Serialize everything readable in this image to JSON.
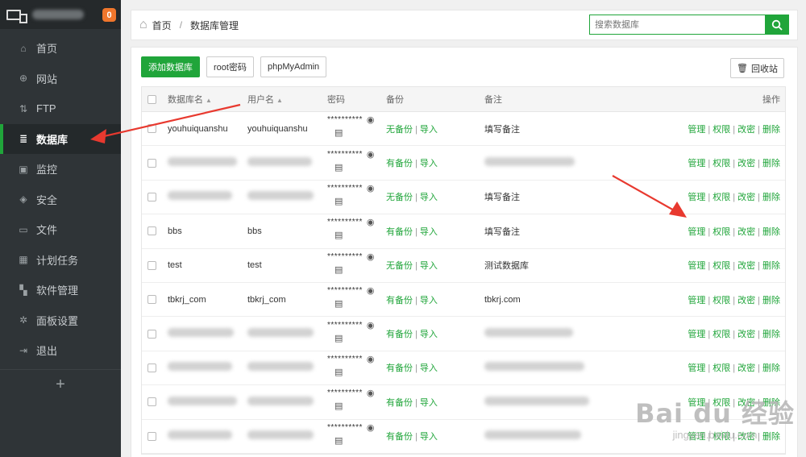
{
  "sidebar": {
    "badge": "0",
    "items": [
      {
        "label": "首页",
        "icon": "home-icon"
      },
      {
        "label": "网站",
        "icon": "globe-icon"
      },
      {
        "label": "FTP",
        "icon": "ftp-icon"
      },
      {
        "label": "数据库",
        "icon": "database-icon"
      },
      {
        "label": "监控",
        "icon": "monitor-icon"
      },
      {
        "label": "安全",
        "icon": "shield-icon"
      },
      {
        "label": "文件",
        "icon": "folder-icon"
      },
      {
        "label": "计划任务",
        "icon": "calendar-icon"
      },
      {
        "label": "软件管理",
        "icon": "apps-icon"
      },
      {
        "label": "面板设置",
        "icon": "gear-icon"
      },
      {
        "label": "退出",
        "icon": "logout-icon"
      }
    ],
    "active_index": 3,
    "add_label": "+"
  },
  "breadcrumb": {
    "home": "首页",
    "separator": "/",
    "current": "数据库管理"
  },
  "search": {
    "placeholder": "搜索数据库"
  },
  "toolbar": {
    "add_db": "添加数据库",
    "root_pwd": "root密码",
    "phpmyadmin": "phpMyAdmin",
    "recycle": "回收站"
  },
  "table": {
    "headers": {
      "name": "数据库名",
      "user": "用户名",
      "password": "密码",
      "backup": "备份",
      "note": "备注",
      "ops": "操作"
    },
    "password_mask": "**********",
    "backup_none": "无备份",
    "backup_has": "有备份",
    "import": "导入",
    "ops": [
      "管理",
      "权限",
      "改密",
      "删除"
    ],
    "rows": [
      {
        "name": "youhuiquanshu",
        "user": "youhuiquanshu",
        "backup": "无备份",
        "note": "填写备注"
      },
      {
        "name": "",
        "user": "",
        "backup": "有备份",
        "note": ""
      },
      {
        "name": "",
        "user": "",
        "backup": "无备份",
        "note": "填写备注"
      },
      {
        "name": "bbs",
        "user": "bbs",
        "backup": "有备份",
        "note": "填写备注"
      },
      {
        "name": "test",
        "user": "test",
        "backup": "无备份",
        "note": "测试数据库"
      },
      {
        "name": "tbkrj_com",
        "user": "tbkrj_com",
        "backup": "有备份",
        "note": "tbkrj.com"
      },
      {
        "name": "",
        "user": "",
        "backup": "有备份",
        "note": ""
      },
      {
        "name": "",
        "user": "",
        "backup": "有备份",
        "note": ""
      },
      {
        "name": "",
        "user": "",
        "backup": "有备份",
        "note": ""
      },
      {
        "name": "",
        "user": "",
        "backup": "有备份",
        "note": ""
      }
    ]
  },
  "watermark": {
    "main": "Bai du 经验",
    "sub": "jingyan.baidu.com"
  },
  "colors": {
    "accent": "#20a53a",
    "sidebar_bg": "#2f3437",
    "badge": "#f0762c",
    "arrow": "#e8392f"
  }
}
